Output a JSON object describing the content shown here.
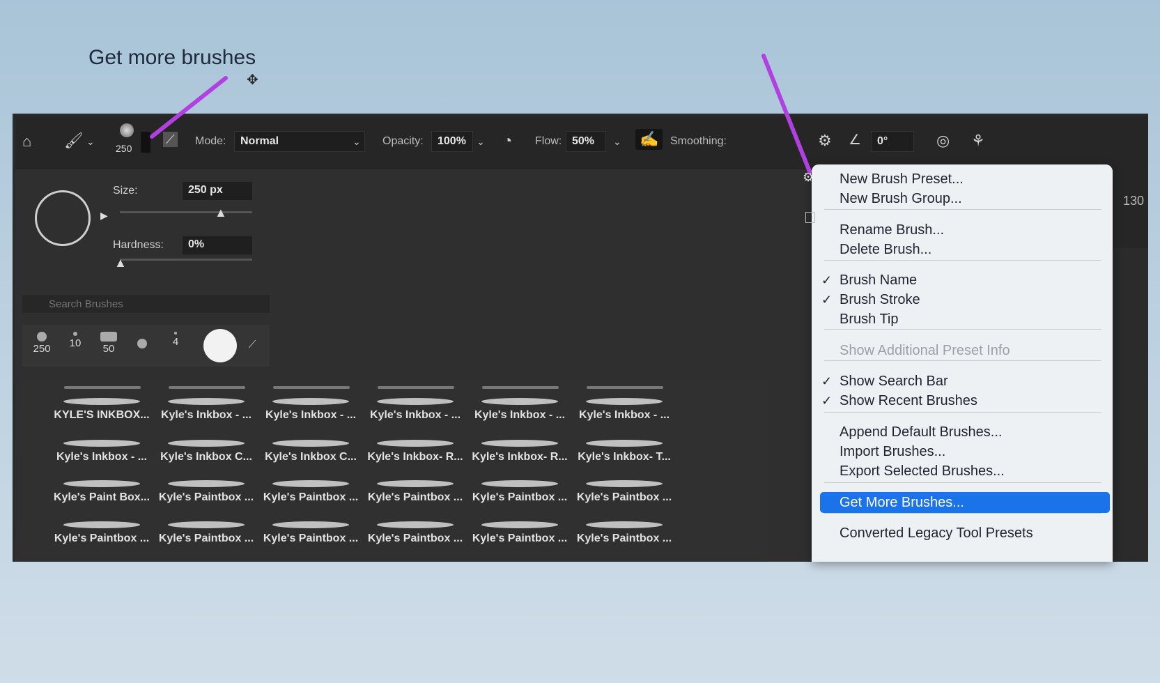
{
  "slide": {
    "title": "Get more brushes"
  },
  "options_bar": {
    "brush_size": "250",
    "mode_label": "Mode:",
    "mode_value": "Normal",
    "opacity_label": "Opacity:",
    "opacity_value": "100%",
    "flow_label": "Flow:",
    "flow_value": "50%",
    "smoothing_label": "Smoothing:",
    "angle_value": "0°"
  },
  "picker": {
    "size_label": "Size:",
    "size_value": "250 px",
    "hardness_label": "Hardness:",
    "hardness_value": "0%",
    "search_placeholder": "Search Brushes",
    "recent": [
      "250",
      "10",
      "50",
      "",
      "4",
      ""
    ],
    "grid_rows": [
      [
        "KYLE'S INKBOX...",
        "Kyle's Inkbox - ...",
        "Kyle's Inkbox - ...",
        "Kyle's Inkbox - ...",
        "Kyle's Inkbox - ...",
        "Kyle's Inkbox - ..."
      ],
      [
        "Kyle's Inkbox - ...",
        "Kyle's Inkbox C...",
        "Kyle's Inkbox C...",
        "Kyle's Inkbox- R...",
        "Kyle's Inkbox- R...",
        "Kyle's Inkbox- T..."
      ],
      [
        "Kyle's Paint Box...",
        "Kyle's Paintbox ...",
        "Kyle's Paintbox ...",
        "Kyle's Paintbox ...",
        "Kyle's Paintbox ...",
        "Kyle's Paintbox ..."
      ],
      [
        "Kyle's Paintbox ...",
        "Kyle's Paintbox ...",
        "Kyle's Paintbox ...",
        "Kyle's Paintbox ...",
        "Kyle's Paintbox ...",
        "Kyle's Paintbox ..."
      ]
    ],
    "right_strip_value": "130"
  },
  "menu": {
    "items": [
      {
        "label": "New Brush Preset...",
        "checked": false,
        "disabled": false
      },
      {
        "label": "New Brush Group...",
        "checked": false,
        "disabled": false
      },
      {
        "label": "Rename Brush...",
        "checked": false,
        "disabled": false
      },
      {
        "label": "Delete Brush...",
        "checked": false,
        "disabled": false
      },
      {
        "label": "Brush Name",
        "checked": true,
        "disabled": false
      },
      {
        "label": "Brush Stroke",
        "checked": true,
        "disabled": false
      },
      {
        "label": "Brush Tip",
        "checked": false,
        "disabled": false
      },
      {
        "label": "Show Additional Preset Info",
        "checked": false,
        "disabled": true
      },
      {
        "label": "Show Search Bar",
        "checked": true,
        "disabled": false
      },
      {
        "label": "Show Recent Brushes",
        "checked": true,
        "disabled": false
      },
      {
        "label": "Append Default Brushes...",
        "checked": false,
        "disabled": false
      },
      {
        "label": "Import Brushes...",
        "checked": false,
        "disabled": false
      },
      {
        "label": "Export Selected Brushes...",
        "checked": false,
        "disabled": false
      },
      {
        "label": "Get More Brushes...",
        "checked": false,
        "disabled": false,
        "highlighted": true
      },
      {
        "label": "Converted Legacy Tool Presets",
        "checked": false,
        "disabled": false
      }
    ],
    "check_glyph": "✓",
    "highlight_color": "#1a73e8"
  },
  "annotation": {
    "arrow_color": "#b040e0"
  }
}
